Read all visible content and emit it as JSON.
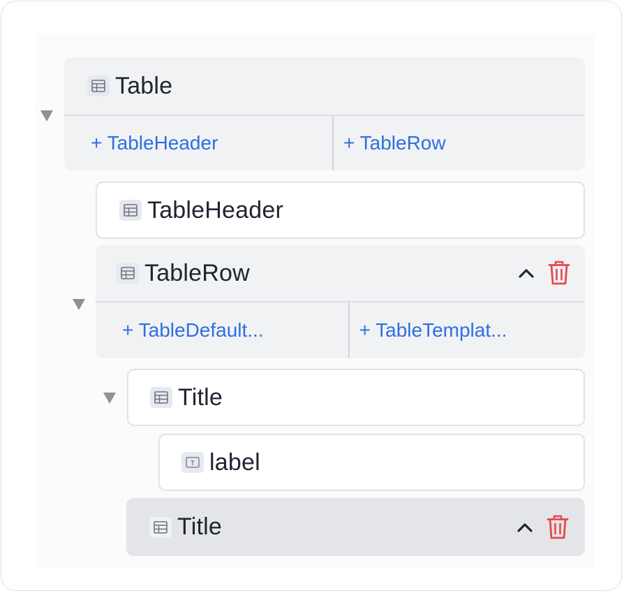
{
  "tree": {
    "table": {
      "label": "Table",
      "icon": "table-icon",
      "expanded": true,
      "add_buttons": [
        "+ TableHeader",
        "+ TableRow"
      ]
    },
    "table_header": {
      "label": "TableHeader",
      "icon": "table-icon"
    },
    "table_row": {
      "label": "TableRow",
      "icon": "table-icon",
      "expanded": true,
      "add_buttons": [
        "+ TableDefault...",
        "+ TableTemplat..."
      ]
    },
    "title_expanded": {
      "label": "Title",
      "icon": "table-icon",
      "expanded": true
    },
    "label_node": {
      "label": "label",
      "icon": "text-icon",
      "icon_glyph": "T"
    },
    "title_selected": {
      "label": "Title",
      "icon": "table-icon",
      "selected": true
    }
  },
  "actions": {
    "collapse_icon": "chevron-up-icon",
    "delete_icon": "trash-icon"
  },
  "colors": {
    "accent": "#2f6fe0",
    "danger": "#e5484d",
    "text": "#1f2430",
    "node_bg": "#f1f2f4",
    "selected_bg": "#e4e5e8"
  }
}
